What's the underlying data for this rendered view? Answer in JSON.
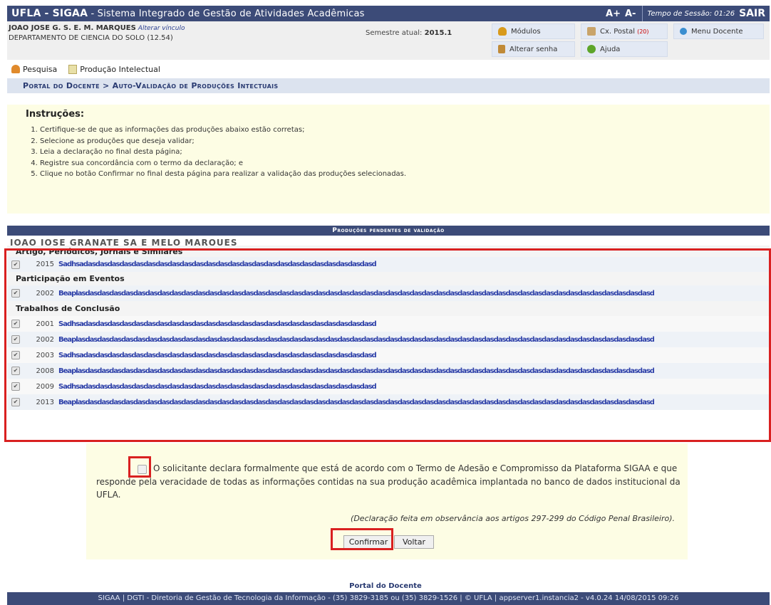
{
  "topbar": {
    "app_short": "UFLA - SIGAA",
    "app_sep": " - ",
    "app_long": "Sistema Integrado de Gestão de Atividades Acadêmicas",
    "font_increase": "A+",
    "font_decrease": "A-",
    "session_label": "Tempo de Sessão: 01:26",
    "logout": "SAIR"
  },
  "user": {
    "name": "JOAO JOSE G. S. E. M. MARQUES",
    "change_link": "Alterar vínculo",
    "department": "DEPARTAMENTO DE CIENCIA DO SOLO (12.54)",
    "semester_label": "Semestre atual:",
    "semester_value": "2015.1"
  },
  "quick": {
    "modules": "Módulos",
    "mailbox": "Cx. Postal",
    "mailbox_count": "(20)",
    "teacher_menu": "Menu Docente",
    "change_password": "Alterar senha",
    "help": "Ajuda"
  },
  "toolbar": {
    "search": "Pesquisa",
    "production": "Produção Intelectual"
  },
  "breadcrumb": "Portal do Docente > Auto-Validação de Produções Intectuais",
  "instructions": {
    "title": "Instruções:",
    "items": [
      "Certifique-se de que as informações das produções abaixo estão corretas;",
      "Selecione as produções que deseja validar;",
      "Leia a declaração no final desta página;",
      "Registre sua concordância com o termo da declaração; e",
      "Clique no botão Confirmar no final desta página para realizar a validação das produções selecionadas."
    ]
  },
  "productions": {
    "header": "Produções pendentes de validação",
    "owner": "JOAO JOSE GRANATE SA E MELO MARQUES",
    "sections": [
      {
        "title": "Artigo, Periódicos, Jornais e Similares",
        "rows": [
          {
            "year": "2015",
            "desc": "Sadhsadasdasdasdasdasdasdasdasdasdasdasdasdasdasdasdasdasdasdasdasdasdasdasdasd"
          }
        ]
      },
      {
        "title": "Participação em Eventos",
        "rows": [
          {
            "year": "2002",
            "desc": "Beaplasdasdasdasdasdasdasdasdasdasdasdasdasdasdasdasdasdasdasdasdasdasdasdasdasdasdasdasdasdasdasdasdasdasdasdasdasdasdasdasdasdasdasdasdasdasdasdasd"
          }
        ]
      },
      {
        "title": "Trabalhos de Conclusão",
        "rows": [
          {
            "year": "2001",
            "desc": "Sadhsadasdasdasdasdasdasdasdasdasdasdasdasdasdasdasdasdasdasdasdasdasdasdasdasd"
          },
          {
            "year": "2002",
            "desc": "Beaplasdasdasdasdasdasdasdasdasdasdasdasdasdasdasdasdasdasdasdasdasdasdasdasdasdasdasdasdasdasdasdasdasdasdasdasdasdasdasdasdasdasdasdasdasdasdasdasd"
          },
          {
            "year": "2003",
            "desc": "Sadhsadasdasdasdasdasdasdasdasdasdasdasdasdasdasdasdasdasdasdasdasdasdasdasdasd"
          },
          {
            "year": "2008",
            "desc": "Beaplasdasdasdasdasdasdasdasdasdasdasdasdasdasdasdasdasdasdasdasdasdasdasdasdasdasdasdasdasdasdasdasdasdasdasdasdasdasdasdasdasdasdasdasdasdasdasdasd"
          },
          {
            "year": "2009",
            "desc": "Sadhsadasdasdasdasdasdasdasdasdasdasdasdasdasdasdasdasdasdasdasdasdasdasdasdasd"
          },
          {
            "year": "2013",
            "desc": "Beaplasdasdasdasdasdasdasdasdasdasdasdasdasdasdasdasdasdasdasdasdasdasdasdasdasdasdasdasdasdasdasdasdasdasdasdasdasdasdasdasdasdasdasdasdasdasdasdasd"
          }
        ]
      }
    ]
  },
  "declaration": {
    "text": "O solicitante declara formalmente que está de acordo com o Termo de Adesão e Compromisso da Plataforma SIGAA e que responde pela veracidade de todas as informações contidas na sua produção acadêmica implantada no banco de dados institucional da UFLA.",
    "note": "(Declaração feita em observância aos artigos 297-299 do Código Penal Brasileiro).",
    "confirm": "Confirmar",
    "back": "Voltar"
  },
  "footer": {
    "portal": "Portal do Docente",
    "text": "SIGAA | DGTI - Diretoria de Gestão de Tecnologia da Informação - (35) 3829-3185 ou (35) 3829-1526 | © UFLA | appserver1.instancia2 - v4.0.24 14/08/2015 09:26"
  },
  "colors": {
    "header_bg": "#3c4b78",
    "highlight": "#d92020",
    "instructions_bg": "#fdfde4",
    "link": "#2c3fa8"
  }
}
